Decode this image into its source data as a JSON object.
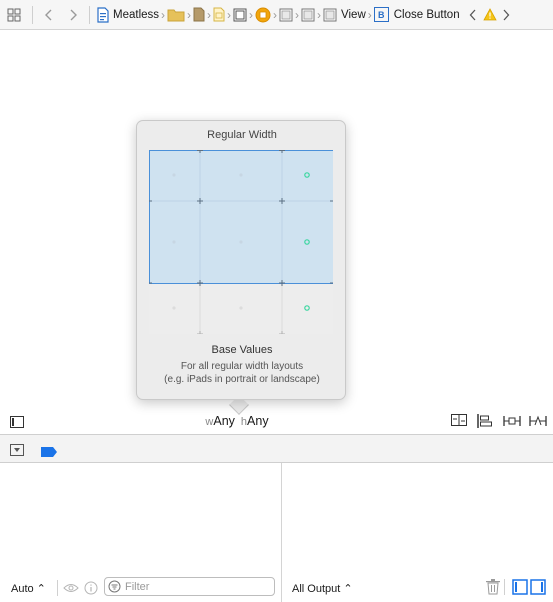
{
  "jumpbar": {
    "project": "Meatless",
    "view_label": "View",
    "button_label": "Close Button",
    "button_badge": "B"
  },
  "popover": {
    "title": "Regular Width",
    "heading": "Base Values",
    "desc_line1": "For all regular width layouts",
    "desc_line2": "(e.g. iPads in portrait or landscape)"
  },
  "sizeclass": {
    "w_prefix": "w",
    "w_value": "Any",
    "h_prefix": "h",
    "h_value": "Any"
  },
  "variables": {
    "scope": "Auto ⌃",
    "filter_placeholder": "Filter"
  },
  "console": {
    "output": "All Output ⌃"
  },
  "colors": {
    "accent": "#1a73e8",
    "selection_fill": "#cfe2f0",
    "selection_border": "#4a90d9",
    "warning": "#f5c518",
    "green_dot": "#3bd6a0"
  }
}
